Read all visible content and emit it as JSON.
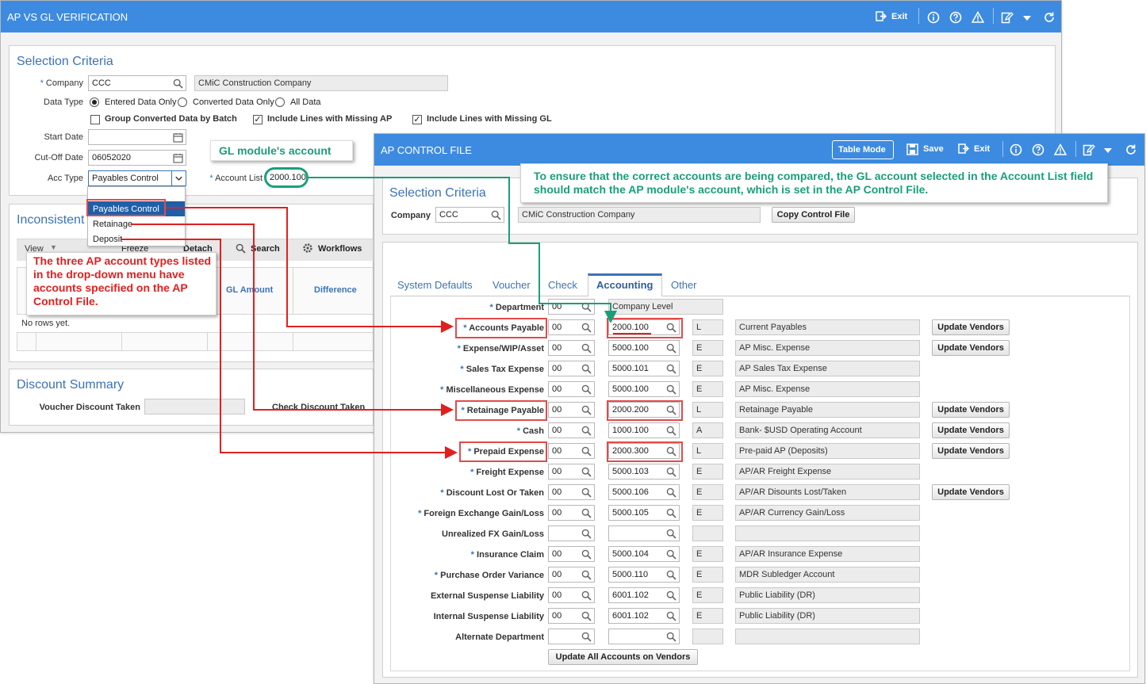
{
  "colors": {
    "titlebar": "#3d8be0",
    "section_title": "#3b73b8",
    "annotation_red": "#e02020",
    "annotation_green": "#1a9e7a"
  },
  "ap_vs_gl": {
    "title": "AP VS GL VERIFICATION",
    "toolbar": {
      "exit_label": "Exit",
      "icons": [
        "info-icon",
        "help-icon",
        "warning-icon",
        "edit-icon",
        "dropdown-icon",
        "refresh-icon"
      ]
    },
    "selection": {
      "title": "Selection Criteria",
      "company_label": "Company",
      "company_value": "CCC",
      "company_name": "CMiC Construction Company",
      "data_type_label": "Data Type",
      "data_type_options": [
        "Entered Data Only",
        "Converted Data Only",
        "All Data"
      ],
      "group_converted_label": "Group Converted Data by Batch",
      "include_missing_ap_label": "Include Lines with Missing AP",
      "include_missing_gl_label": "Include Lines with Missing GL",
      "start_date_label": "Start Date",
      "start_date_value": "",
      "cutoff_date_label": "Cut-Off Date",
      "cutoff_date_value": "06052020",
      "acc_type_label": "Acc Type",
      "acc_type_value": "Payables Control",
      "account_list_label": "Account List",
      "account_list_value": "2000.100",
      "dropdown_options": [
        "Payables Control",
        "Retainage",
        "Deposit"
      ]
    },
    "inconsistent": {
      "title": "Inconsistent",
      "view_label": "View",
      "freeze_label": "Freeze",
      "detach_label": "Detach",
      "search_label": "Search",
      "workflows_label": "Workflows",
      "columns": [
        "GL Amount",
        "Difference"
      ],
      "empty_text": "No rows yet."
    },
    "discount": {
      "title": "Discount Summary",
      "voucher_label": "Voucher Discount Taken",
      "check_label": "Check Discount Taken"
    }
  },
  "ap_control": {
    "title": "AP CONTROL FILE",
    "toolbar": {
      "table_mode_label": "Table Mode",
      "save_label": "Save",
      "exit_label": "Exit"
    },
    "selection": {
      "title": "Selection Criteria",
      "company_label": "Company",
      "company_value": "CCC",
      "company_name": "CMiC Construction Company",
      "copy_button": "Copy Control File"
    },
    "tabs": [
      "System Defaults",
      "Voucher",
      "Check",
      "Accounting",
      "Other"
    ],
    "active_tab": "Accounting",
    "department": {
      "label": "Department",
      "value": "00",
      "name": "Company Level"
    },
    "rows": [
      {
        "label": "Accounts Payable",
        "required": true,
        "dept": "00",
        "account": "2000.100",
        "type": "L",
        "desc": "Current Payables",
        "update": "Update Vendors"
      },
      {
        "label": "Expense/WIP/Asset",
        "required": true,
        "dept": "00",
        "account": "5000.100",
        "type": "E",
        "desc": "AP Misc. Expense",
        "update": "Update Vendors"
      },
      {
        "label": "Sales Tax Expense",
        "required": true,
        "dept": "00",
        "account": "5000.101",
        "type": "E",
        "desc": "AP Sales Tax Expense",
        "update": ""
      },
      {
        "label": "Miscellaneous Expense",
        "required": true,
        "dept": "00",
        "account": "5000.100",
        "type": "E",
        "desc": "AP Misc. Expense",
        "update": ""
      },
      {
        "label": "Retainage Payable",
        "required": true,
        "dept": "00",
        "account": "2000.200",
        "type": "L",
        "desc": "Retainage Payable",
        "update": "Update Vendors"
      },
      {
        "label": "Cash",
        "required": true,
        "dept": "00",
        "account": "1000.100",
        "type": "A",
        "desc": "Bank- $USD Operating Account",
        "update": "Update Vendors"
      },
      {
        "label": "Prepaid Expense",
        "required": true,
        "dept": "00",
        "account": "2000.300",
        "type": "L",
        "desc": "Pre-paid AP (Deposits)",
        "update": "Update Vendors"
      },
      {
        "label": "Freight Expense",
        "required": true,
        "dept": "00",
        "account": "5000.103",
        "type": "E",
        "desc": "AP/AR Freight Expense",
        "update": ""
      },
      {
        "label": "Discount Lost Or Taken",
        "required": true,
        "dept": "00",
        "account": "5000.106",
        "type": "E",
        "desc": "AP/AR Disounts Lost/Taken",
        "update": "Update Vendors"
      },
      {
        "label": "Foreign Exchange Gain/Loss",
        "required": true,
        "dept": "00",
        "account": "5000.105",
        "type": "E",
        "desc": "AP/AR Currency Gain/Loss",
        "update": ""
      },
      {
        "label": "Unrealized FX Gain/Loss",
        "required": false,
        "dept": "",
        "account": "",
        "type": "",
        "desc": "",
        "update": ""
      },
      {
        "label": "Insurance Claim",
        "required": true,
        "dept": "00",
        "account": "5000.104",
        "type": "E",
        "desc": "AP/AR Insurance Expense",
        "update": ""
      },
      {
        "label": "Purchase Order Variance",
        "required": true,
        "dept": "00",
        "account": "5000.110",
        "type": "E",
        "desc": "MDR Subledger Account",
        "update": ""
      },
      {
        "label": "External Suspense Liability",
        "required": false,
        "dept": "00",
        "account": "6001.102",
        "type": "E",
        "desc": "Public Liability (DR)",
        "update": ""
      },
      {
        "label": "Internal Suspense Liability",
        "required": false,
        "dept": "00",
        "account": "6001.102",
        "type": "E",
        "desc": "Public Liability (DR)",
        "update": ""
      },
      {
        "label": "Alternate Department",
        "required": false,
        "dept": "",
        "account": "",
        "type": "",
        "desc": "",
        "update": ""
      }
    ],
    "update_all_label": "Update All Accounts on Vendors"
  },
  "annotations": {
    "gl_module": "GL module's account",
    "ensure_note": "To ensure that the correct accounts are being compared, the GL account selected in the Account List field should match the AP module's account, which is set in the AP Control File.",
    "three_types": "The three AP account types listed in the drop-down menu have accounts specified on the AP Control File."
  }
}
